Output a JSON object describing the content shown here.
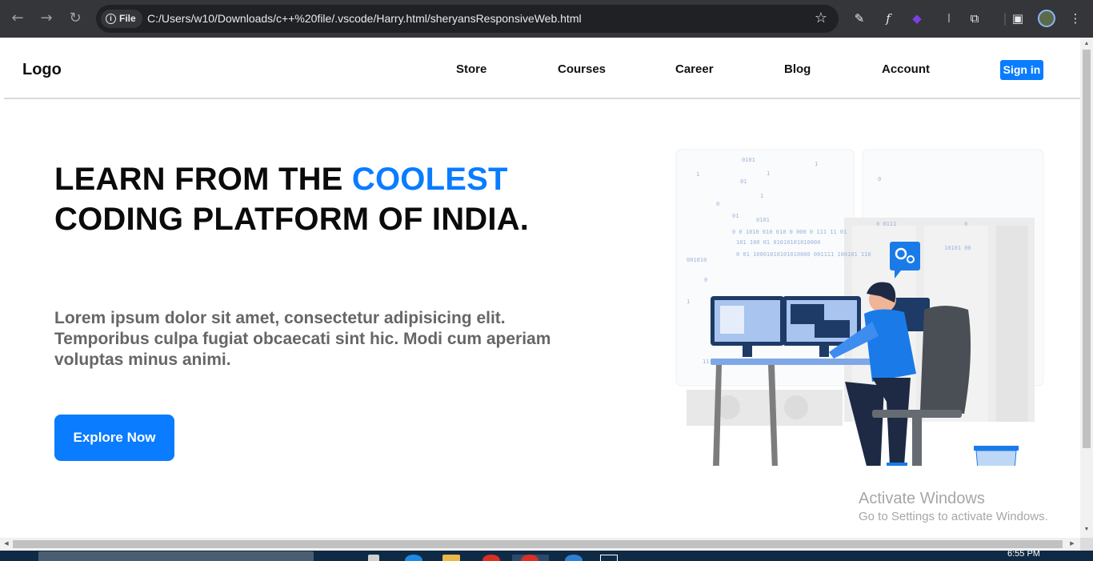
{
  "browser": {
    "back_icon": "arrow-left-icon",
    "forward_icon": "arrow-right-icon",
    "reload_icon": "reload-icon",
    "chip_label": "File",
    "url": "C:/Users/w10/Downloads/c++%20file/.vscode/Harry.html/sheryansResponsiveWeb.html"
  },
  "navbar": {
    "logo": "Logo",
    "links": [
      "Store",
      "Courses",
      "Career",
      "Blog",
      "Account"
    ],
    "signin": "Sign in"
  },
  "hero": {
    "title_part1": "LEARN FROM THE ",
    "title_accent": "COOLEST",
    "title_part2": "CODING PLATFORM OF INDIA.",
    "text": "Lorem ipsum dolor sit amet, consectetur adipisicing elit. Temporibus culpa fugiat obcaecati sint hic. Modi cum aperiam voluptas minus animi.",
    "button": "Explore Now"
  },
  "watermark": {
    "title": "Activate Windows",
    "subtitle": "Go to Settings to activate Windows."
  },
  "taskbar": {
    "time": "6:55 PM"
  },
  "colors": {
    "accent": "#0a7cff",
    "chrome": "#35363a"
  }
}
